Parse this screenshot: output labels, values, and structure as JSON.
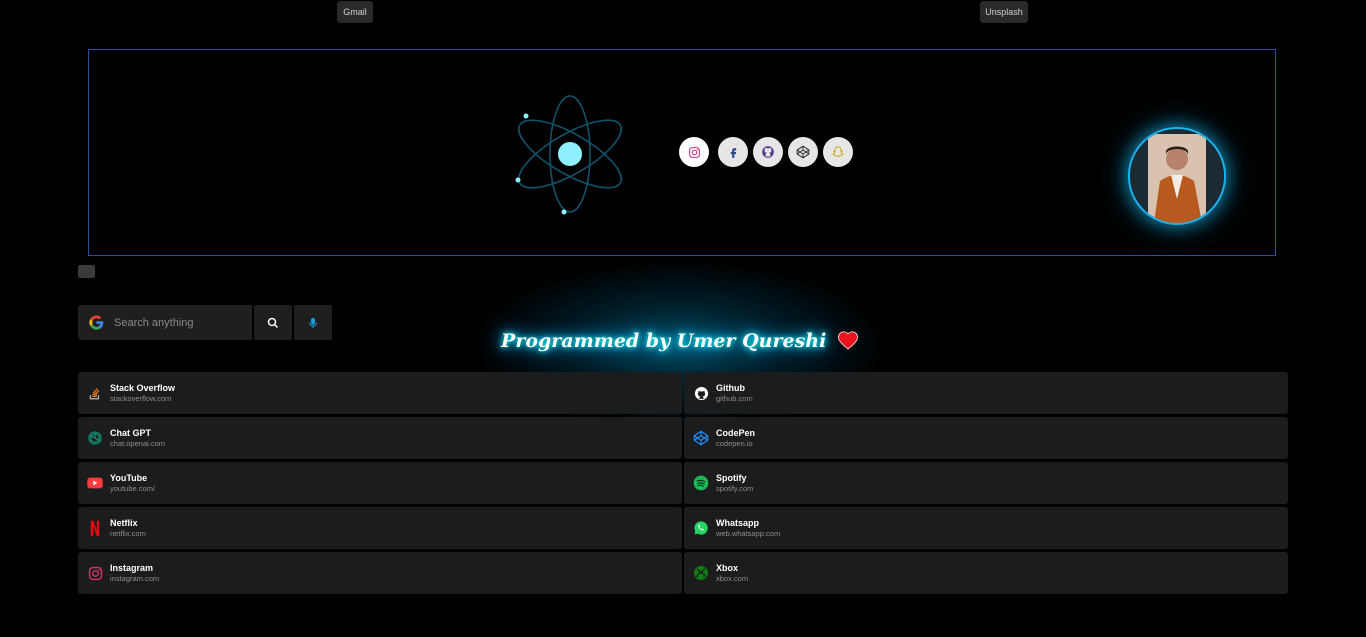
{
  "top_links": {
    "gmail": "Gmail",
    "unsplash": "Unsplash"
  },
  "search": {
    "placeholder": "Search anything"
  },
  "credit": {
    "text": "Programmed by Umer Qureshi"
  },
  "social_icons": [
    "instagram-icon",
    "facebook-icon",
    "github-icon",
    "codepen-icon",
    "snapchat-icon"
  ],
  "links": [
    {
      "name": "Stack Overflow",
      "url": "stackoverflow.com",
      "icon": "stackoverflow-icon",
      "color": "#f48024"
    },
    {
      "name": "Github",
      "url": "github.com",
      "icon": "github-icon",
      "color": "#ffffff"
    },
    {
      "name": "Chat GPT",
      "url": "chat.openai.com",
      "icon": "chatgpt-icon",
      "color": "#10a37f"
    },
    {
      "name": "CodePen",
      "url": "codepen.io",
      "icon": "codepen-icon",
      "color": "#1e90ff"
    },
    {
      "name": "YouTube",
      "url": "youtube.com/",
      "icon": "youtube-icon",
      "color": "#ff3d3d"
    },
    {
      "name": "Spotify",
      "url": "spotify.com",
      "icon": "spotify-icon",
      "color": "#1db954"
    },
    {
      "name": "Netflix",
      "url": "netflix.com",
      "icon": "netflix-icon",
      "color": "#e50914"
    },
    {
      "name": "Whatsapp",
      "url": "web.whatsapp.com",
      "icon": "whatsapp-icon",
      "color": "#25d366"
    },
    {
      "name": "Instagram",
      "url": "instagram.com",
      "icon": "instagram-icon",
      "color": "#e1306c"
    },
    {
      "name": "Xbox",
      "url": "xbox.com",
      "icon": "xbox-icon",
      "color": "#107c10"
    }
  ],
  "colors": {
    "accent": "#18b6f0",
    "hero_border": "#2b4f9e",
    "card_bg": "#1b1c1d"
  }
}
